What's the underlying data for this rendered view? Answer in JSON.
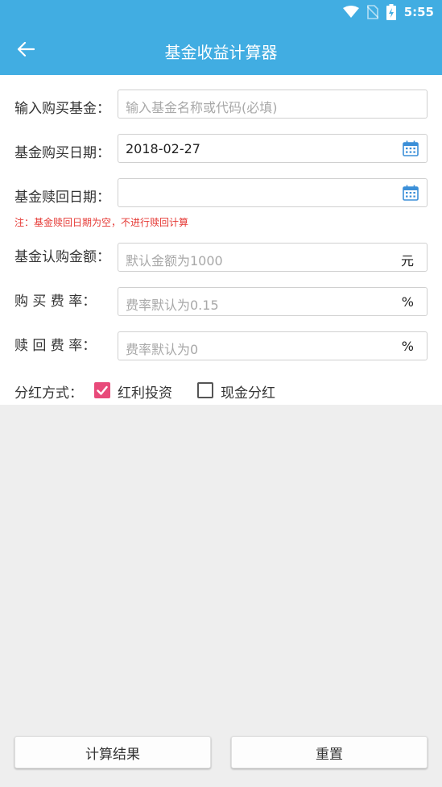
{
  "status_bar": {
    "time": "5:55",
    "icons": [
      "wifi-icon",
      "no-sim-icon",
      "battery-charging-icon"
    ]
  },
  "app_bar": {
    "title": "基金收益计算器",
    "back_icon": "arrow-left-icon"
  },
  "form": {
    "fund": {
      "label": "输入购买基金：",
      "value": "",
      "placeholder": "输入基金名称或代码(必填)"
    },
    "buy_date": {
      "label": "基金购买日期：",
      "value": "2018-02-27",
      "icon": "calendar-icon"
    },
    "redeem_date": {
      "label": "基金赎回日期：",
      "value": "",
      "icon": "calendar-icon"
    },
    "note": "注：基金赎回日期为空，不进行赎回计算",
    "amount": {
      "label": "基金认购金额：",
      "placeholder": "默认金额为1000",
      "suffix": "元"
    },
    "buy_rate": {
      "label": "购 买 费 率：",
      "placeholder": "费率默认为0.15",
      "suffix": "%"
    },
    "redeem_rate": {
      "label": "赎 回 费 率：",
      "placeholder": "费率默认为0",
      "suffix": "%"
    },
    "dividend": {
      "label": "分红方式：",
      "options": [
        {
          "label": "红利投资",
          "checked": true
        },
        {
          "label": "现金分红",
          "checked": false
        }
      ]
    }
  },
  "buttons": {
    "calculate": "计算结果",
    "reset": "重置"
  },
  "colors": {
    "primary": "#41ade2",
    "checkbox_on": "#e84a7a",
    "note": "#e53935",
    "background": "#eeeeee"
  }
}
